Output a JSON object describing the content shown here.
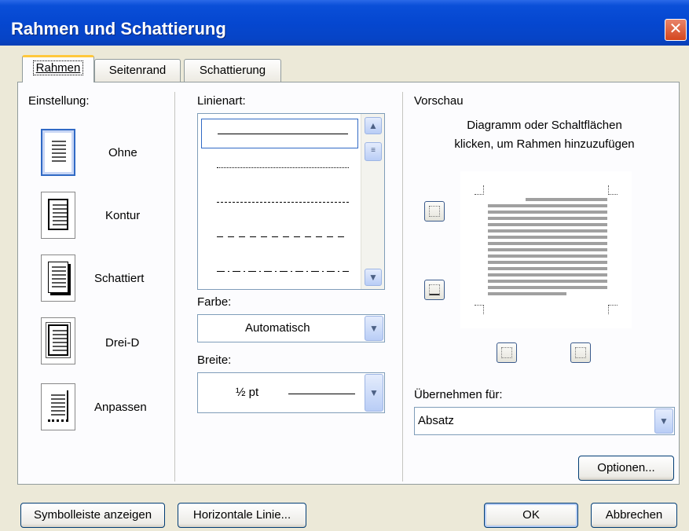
{
  "window": {
    "title": "Rahmen und Schattierung",
    "close_symbol": "✕"
  },
  "tabs": [
    {
      "label": "Rahmen"
    },
    {
      "label": "Seitenrand"
    },
    {
      "label": "Schattierung"
    }
  ],
  "settings": {
    "heading": "Einstellung:",
    "items": [
      {
        "label": "Ohne",
        "selected": true
      },
      {
        "label": "Kontur"
      },
      {
        "label": "Schattiert"
      },
      {
        "label": "Drei-D"
      },
      {
        "label": "Anpassen"
      }
    ]
  },
  "line_style": {
    "label": "Linienart:",
    "styles": [
      "solid",
      "dotted",
      "dashed-fine",
      "dashed",
      "dash-dot"
    ]
  },
  "color": {
    "label": "Farbe:",
    "value": "Automatisch"
  },
  "width": {
    "label": "Breite:",
    "value": "½ pt"
  },
  "preview": {
    "heading": "Vorschau",
    "hint_line1": "Diagramm oder Schaltflächen",
    "hint_line2": "klicken, um Rahmen hinzuzufügen"
  },
  "apply_to": {
    "label": "Übernehmen für:",
    "value": "Absatz"
  },
  "buttons": {
    "options": "Optionen...",
    "toolbar": "Symbolleiste anzeigen",
    "horizontal_line": "Horizontale Linie...",
    "ok": "OK",
    "cancel": "Abbrechen"
  },
  "colors": {
    "titlebar": "#0547d0",
    "dialog_bg": "#ece9d8",
    "tab_accent": "#ffc83c",
    "close": "#d4461e"
  }
}
